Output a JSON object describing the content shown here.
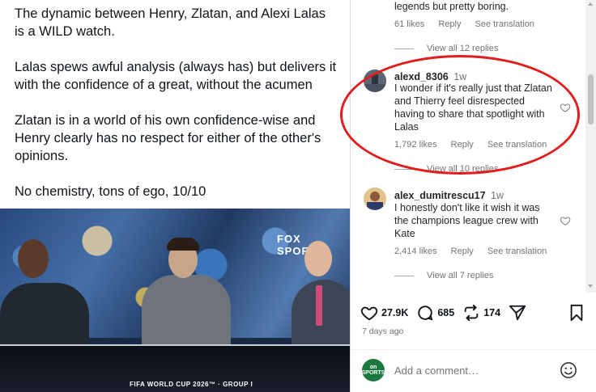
{
  "post": {
    "paragraphs": [
      "The dynamic between Henry, Zlatan, and Alexi Lalas is a WILD watch.",
      "Lalas spews awful analysis (always has) but delivers it with the confidence of a great, without the acumen",
      "Zlatan is in a world of his own confidence-wise and Henry clearly has no respect for either of the other's opinions.",
      "No chemistry, tons of ego, 10/10"
    ],
    "image": {
      "overlay_logo": "FOX SPORTS",
      "caption": "FIFA WORLD CUP 2026™ · GROUP I"
    }
  },
  "comments": {
    "top_partial": {
      "text": "legends but pretty boring.",
      "likes": "61 likes",
      "reply": "Reply",
      "translate": "See translation",
      "view_replies": "View all 12 replies"
    },
    "items": [
      {
        "username": "alexd_8306",
        "time": "1w",
        "text": "I wonder if it's really just that Zlatan and Thierry feel disrespected having to share that spotlight with Lalas",
        "likes": "1,792 likes",
        "reply": "Reply",
        "translate": "See translation",
        "view_replies": "View all 10 replies"
      },
      {
        "username": "alex_dumitrescu17",
        "time": "1w",
        "text": "I honestly don't like it wish it was the champions league crew with Kate",
        "likes": "2,414 likes",
        "reply": "Reply",
        "translate": "See translation",
        "view_replies": "View all 7 replies"
      }
    ]
  },
  "actions": {
    "likes": "27.9K",
    "comments": "685",
    "reposts": "174",
    "posted": "7 days ago",
    "commenter_avatar_text": "on SPORTS",
    "add_comment_placeholder": "Add a comment…"
  },
  "icons": {
    "like": "heart-icon",
    "comment": "comment-bubble-icon",
    "repost": "repost-icon",
    "share": "send-icon",
    "save": "bookmark-icon",
    "emoji": "smiley-icon"
  },
  "annotation_color": "#e01e1e"
}
